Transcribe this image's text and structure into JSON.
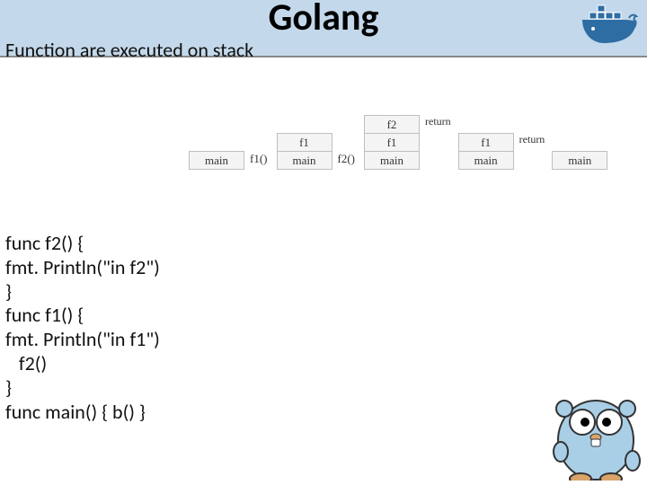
{
  "title": "Golang",
  "subtitle": "Function are executed on stack",
  "code": "func f2() {\nfmt. Println(\"in f2\")\n}\nfunc f1() {\nfmt. Println(\"in f1\")\n   f2()\n}\nfunc main() { b() }",
  "diagram": {
    "columns": [
      {
        "stack": [
          "main"
        ],
        "side_call": "f1()"
      },
      {
        "stack": [
          "f1",
          "main"
        ],
        "side_call": "f2()"
      },
      {
        "stack": [
          "f2",
          "f1",
          "main"
        ],
        "side_return": "return"
      },
      {
        "stack": [
          "f1",
          "main"
        ],
        "side_return": "return"
      },
      {
        "stack": [
          "main"
        ]
      }
    ]
  },
  "icons": {
    "docker": "docker-whale-icon",
    "gopher": "go-gopher-mascot"
  }
}
